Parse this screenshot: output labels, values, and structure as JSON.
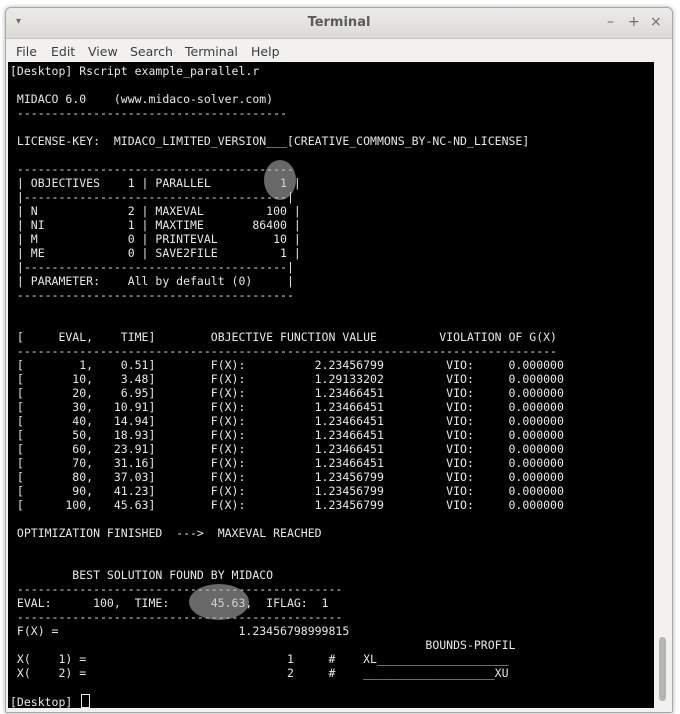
{
  "window": {
    "title": "Terminal",
    "menu_icon": "▾",
    "minimize": "–",
    "maximize": "+",
    "close": "×"
  },
  "menu": [
    "File",
    "Edit",
    "View",
    "Search",
    "Terminal",
    "Help"
  ],
  "terminal": {
    "lines": [
      "[Desktop] Rscript example_parallel.r",
      "",
      " MIDACO 6.0    (www.midaco-solver.com)",
      " ---------------------------------------",
      "",
      " LICENSE-KEY:  MIDACO_LIMITED_VERSION___[CREATIVE_COMMONS_BY-NC-ND_LICENSE]",
      "",
      " ----------------------------------------",
      " | OBJECTIVES    1 | PARALLEL          1 |",
      " |--------------------------------------|",
      " | N             2 | MAXEVAL         100 |",
      " | NI            1 | MAXTIME       86400 |",
      " | M             0 | PRINTEVAL        10 |",
      " | ME            0 | SAVE2FILE         1 |",
      " |--------------------------------------|",
      " | PARAMETER:    All by default (0)     |",
      " ----------------------------------------",
      "",
      "",
      " [     EVAL,    TIME]        OBJECTIVE FUNCTION VALUE         VIOLATION OF G(X)",
      " ------------------------------------------------------------------------------",
      " [        1,    0.51]        F(X):          2.23456799         VIO:     0.000000",
      " [       10,    3.48]        F(X):          1.29133202         VIO:     0.000000",
      " [       20,    6.95]        F(X):          1.23466451         VIO:     0.000000",
      " [       30,   10.91]        F(X):          1.23466451         VIO:     0.000000",
      " [       40,   14.94]        F(X):          1.23466451         VIO:     0.000000",
      " [       50,   18.93]        F(X):          1.23466451         VIO:     0.000000",
      " [       60,   23.91]        F(X):          1.23466451         VIO:     0.000000",
      " [       70,   31.16]        F(X):          1.23466451         VIO:     0.000000",
      " [       80,   37.03]        F(X):          1.23456799         VIO:     0.000000",
      " [       90,   41.23]        F(X):          1.23456799         VIO:     0.000000",
      " [      100,   45.63]        F(X):          1.23456799         VIO:     0.000000",
      "",
      " OPTIMIZATION FINISHED  --->  MAXEVAL REACHED",
      "",
      "",
      "         BEST SOLUTION FOUND BY MIDACO",
      " -----------------------------------------------",
      " EVAL:      100,  TIME:      45.63,  IFLAG:  1",
      " -----------------------------------------------",
      " F(X) =                          1.23456798999815",
      "                                                            BOUNDS-PROFIL",
      " X(    1) =                             1     #    XL___________________",
      " X(    2) =                             2     #    ___________________XU",
      ""
    ],
    "prompt": "[Desktop] "
  }
}
